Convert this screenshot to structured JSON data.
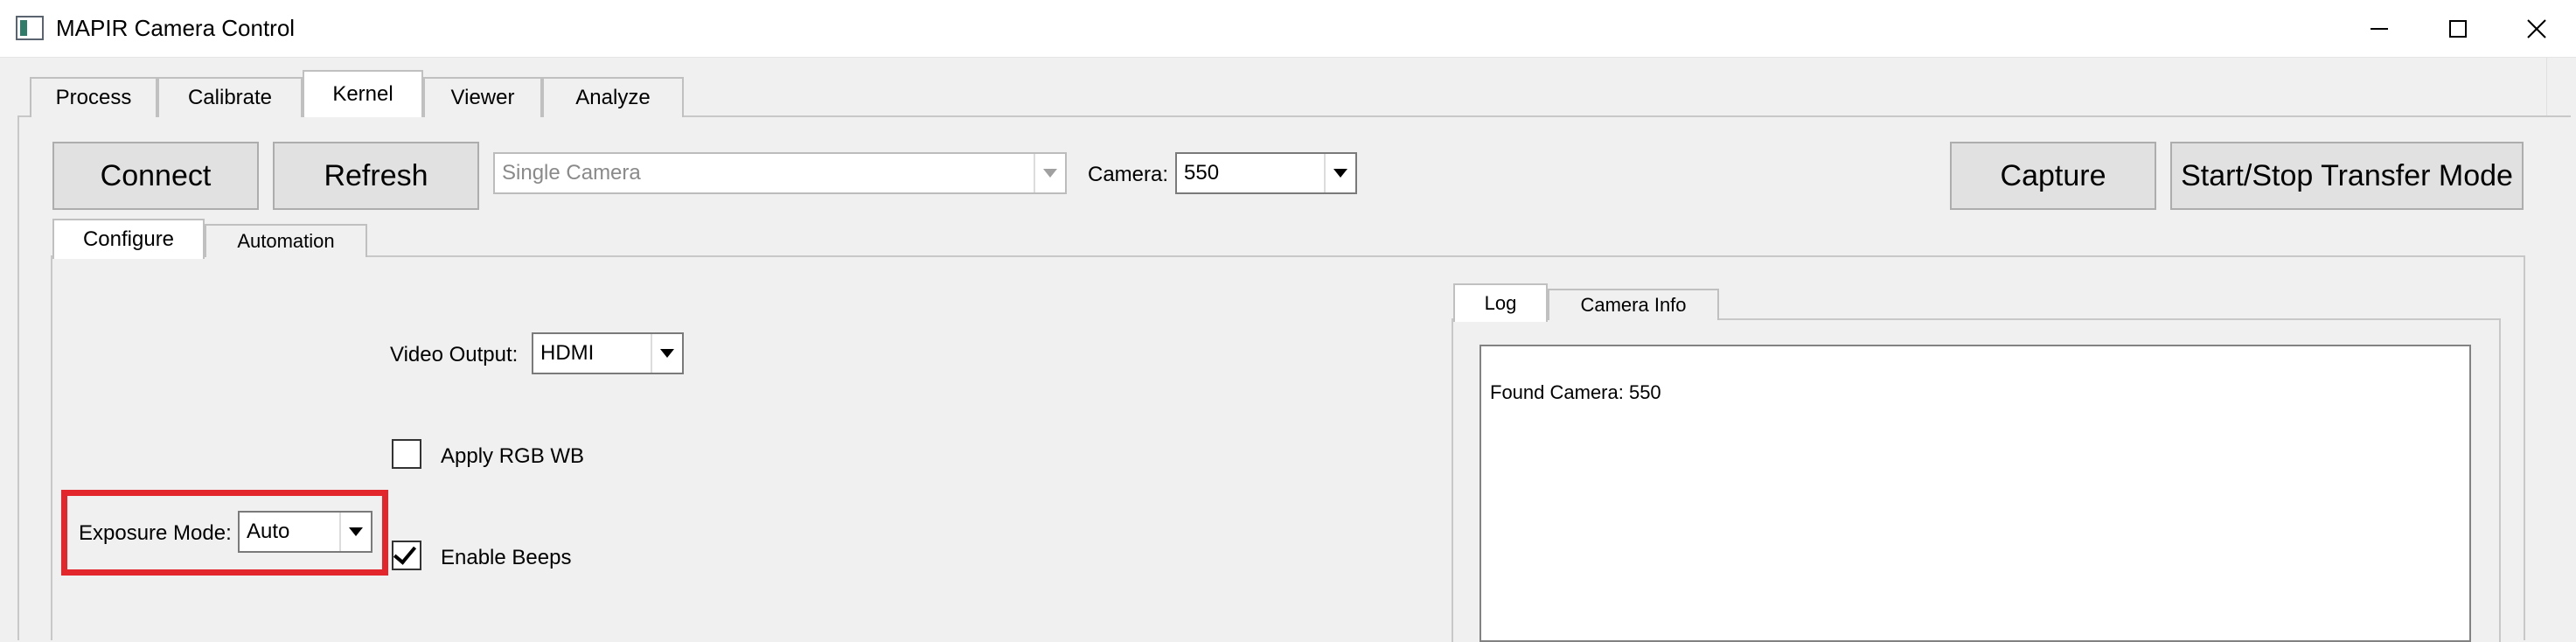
{
  "window": {
    "title": "MAPIR Camera Control",
    "icon": "mapir-app-icon",
    "controls": [
      "minimize-icon",
      "maximize-icon",
      "close-icon"
    ]
  },
  "outer_tabs": [
    {
      "label": "Process",
      "active": false
    },
    {
      "label": "Calibrate",
      "active": false
    },
    {
      "label": "Kernel",
      "active": true
    },
    {
      "label": "Viewer",
      "active": false
    },
    {
      "label": "Analyze",
      "active": false
    }
  ],
  "toolbar": {
    "connect_label": "Connect",
    "refresh_label": "Refresh",
    "mode_select": {
      "value": "Single Camera",
      "enabled": false
    },
    "camera_label": "Camera:",
    "camera_select": {
      "value": "550"
    },
    "capture_label": "Capture",
    "transfer_label": "Start/Stop Transfer Mode"
  },
  "inner_tabs": [
    {
      "label": "Configure",
      "active": true
    },
    {
      "label": "Automation",
      "active": false
    }
  ],
  "configure": {
    "video_output_label": "Video Output:",
    "video_output_value": "HDMI",
    "apply_rgb_wb_label": "Apply RGB WB",
    "apply_rgb_wb_checked": false,
    "exposure_mode_label": "Exposure Mode:",
    "exposure_mode_value": "Auto",
    "enable_beeps_label": "Enable Beeps",
    "enable_beeps_checked": true
  },
  "log_tabs": [
    {
      "label": "Log",
      "active": true
    },
    {
      "label": "Camera Info",
      "active": false
    }
  ],
  "log": {
    "text": "Found Camera: 550"
  },
  "highlight_color": "#e3262b"
}
